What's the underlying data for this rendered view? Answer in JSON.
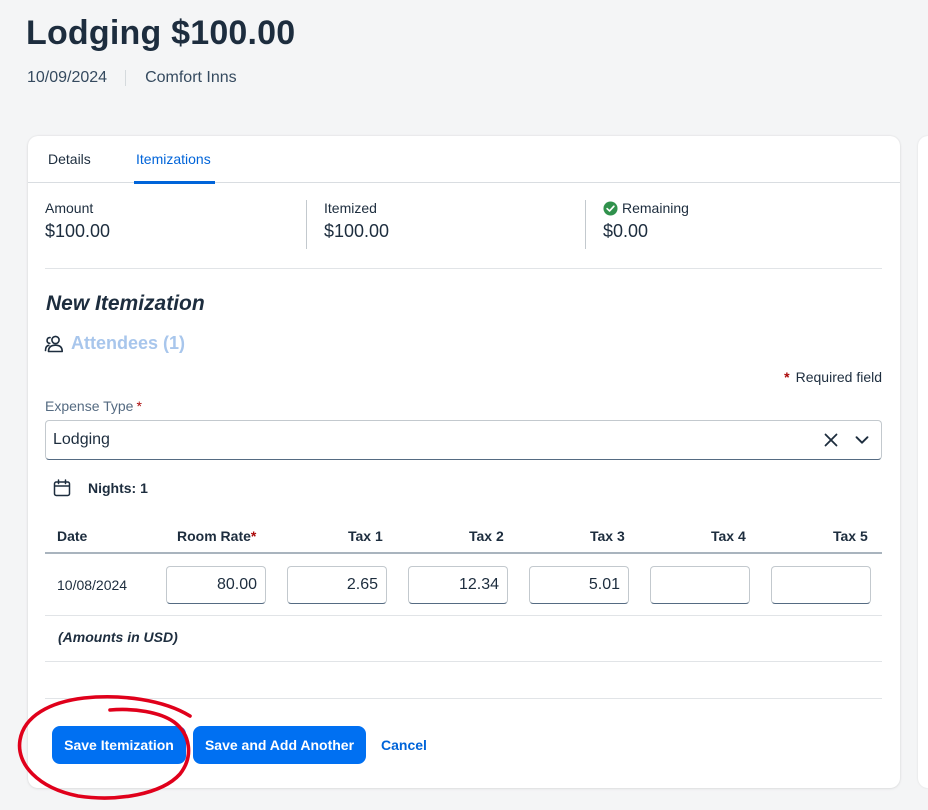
{
  "header": {
    "title": "Lodging $100.00",
    "date": "10/09/2024",
    "vendor": "Comfort Inns"
  },
  "tabs": [
    {
      "label": "Details",
      "active": false
    },
    {
      "label": "Itemizations",
      "active": true
    }
  ],
  "summary": {
    "amount_label": "Amount",
    "amount_value": "$100.00",
    "itemized_label": "Itemized",
    "itemized_value": "$100.00",
    "remaining_label": "Remaining",
    "remaining_value": "$0.00",
    "remaining_icon": "check-circle-icon"
  },
  "form": {
    "section_title": "New Itemization",
    "attendees_label": "Attendees (1)",
    "required_symbol": "*",
    "required_note": "Required field",
    "expense_type_label": "Expense Type",
    "expense_type_value": "Lodging",
    "nights_label": "Nights: 1",
    "amounts_note": "(Amounts in USD)"
  },
  "table": {
    "headers": {
      "date": "Date",
      "room_rate": "Room Rate",
      "tax1": "Tax 1",
      "tax2": "Tax 2",
      "tax3": "Tax 3",
      "tax4": "Tax 4",
      "tax5": "Tax 5"
    },
    "rows": [
      {
        "date": "10/08/2024",
        "room_rate": "80.00",
        "tax1": "2.65",
        "tax2": "12.34",
        "tax3": "5.01",
        "tax4": "",
        "tax5": ""
      }
    ]
  },
  "buttons": {
    "save": "Save Itemization",
    "save_add": "Save and Add Another",
    "cancel": "Cancel"
  },
  "colors": {
    "accent": "#0070f2",
    "link": "#0064d9",
    "success": "#30914c",
    "required": "#aa0808",
    "annotation": "#e0001b"
  }
}
